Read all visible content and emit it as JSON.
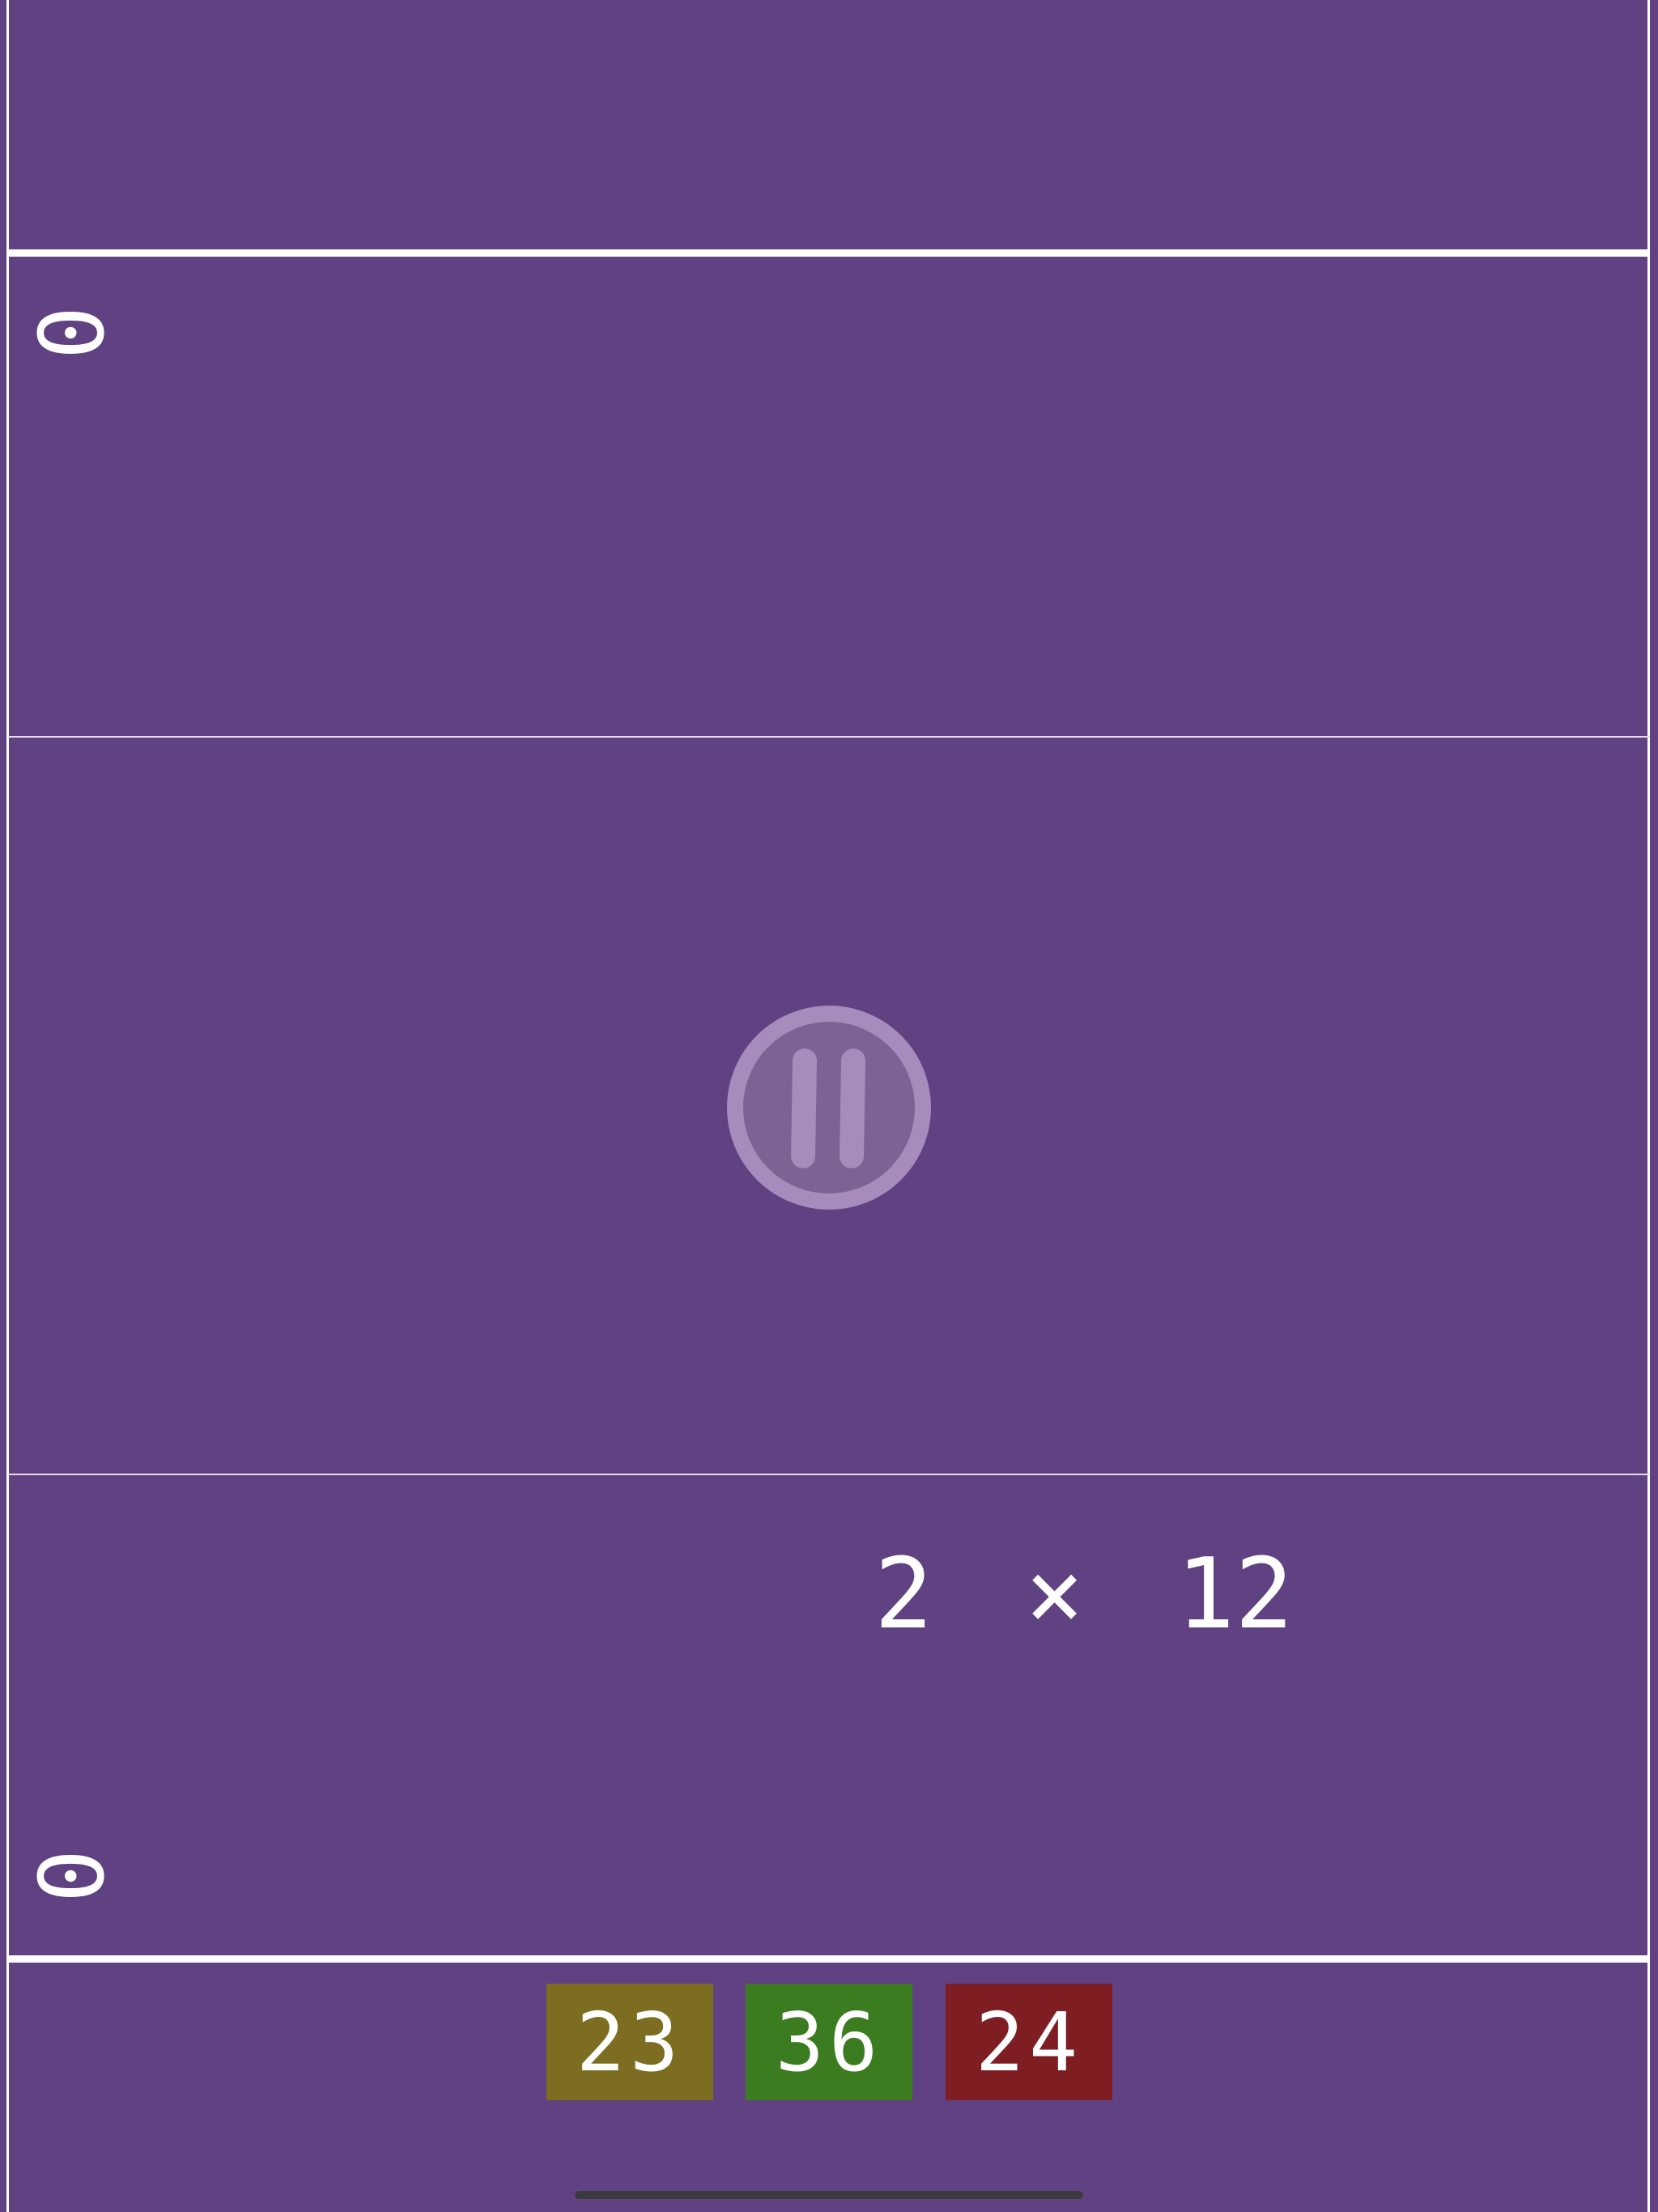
{
  "game": {
    "top_score": "0",
    "bottom_score": "0",
    "problem": "2 × 12",
    "answers": [
      {
        "value": "23",
        "color": "#7d6d20"
      },
      {
        "value": "36",
        "color": "#3b7c21"
      },
      {
        "value": "24",
        "color": "#7e1d22"
      }
    ]
  },
  "icons": {
    "pause": "pause-icon"
  },
  "colors": {
    "background": "#604282",
    "lines": "#ffffff"
  }
}
